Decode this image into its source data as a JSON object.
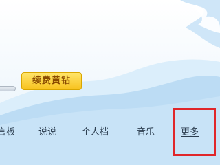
{
  "colors": {
    "sky_light": "#eaf4fc",
    "sky_mid": "#c9e4f7",
    "wave_light": "#d7ecfa",
    "wave_blue": "#b8dcf5",
    "button_yellow": "#f8c21e",
    "button_text": "#8a4b00",
    "nav_text": "#2c3e50",
    "highlight_red": "#e0262a"
  },
  "header": {
    "renew_button": "续费黄钻"
  },
  "nav": {
    "items": [
      {
        "label": "言板",
        "icon": ""
      },
      {
        "label": "说说"
      },
      {
        "label": "个人档"
      },
      {
        "label": "音乐"
      },
      {
        "label": "更多",
        "highlighted": true
      }
    ]
  }
}
